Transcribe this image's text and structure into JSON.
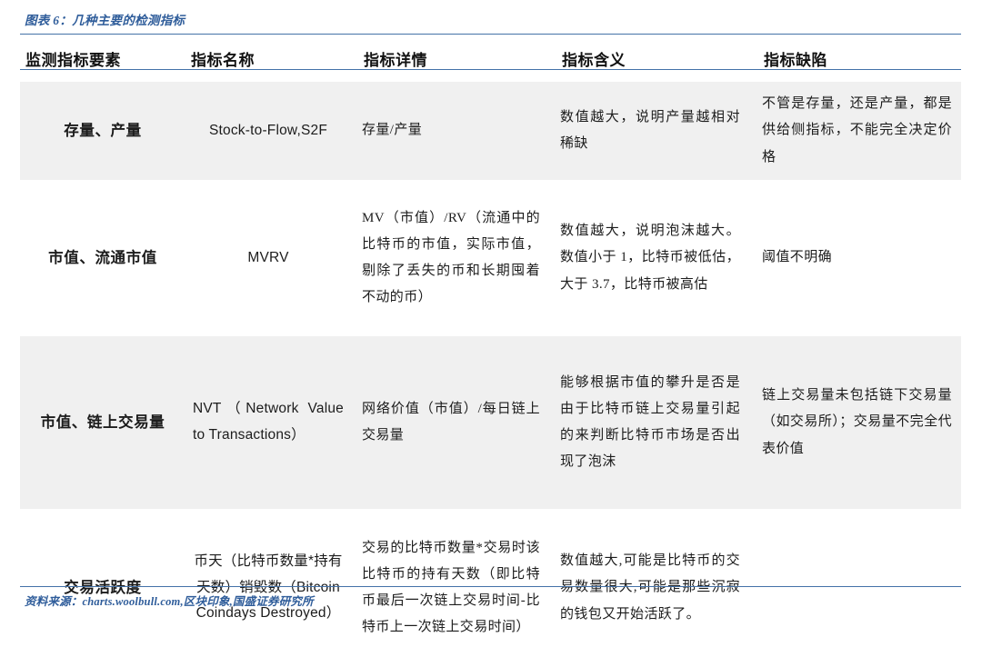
{
  "exhibit": {
    "title": "图表 6：几种主要的检测指标",
    "source": "资料来源：charts.woolbull.com,区块印象,国盛证券研究所",
    "accent_color": "#2e5c9a",
    "rule_color": "#4472a8",
    "shaded_row_color": "#f0f0f0"
  },
  "table": {
    "headers": [
      "监测指标要素",
      "指标名称",
      "指标详情",
      "指标含义",
      "指标缺陷"
    ],
    "rows": [
      {
        "element": "存量、产量",
        "name": "Stock-to-Flow,S2F",
        "detail": "存量/产量",
        "meaning": "数值越大，说明产量越相对稀缺",
        "flaw": "不管是存量，还是产量，都是供给侧指标，不能完全决定价格",
        "shaded": true
      },
      {
        "element": "市值、流通市值",
        "name": "MVRV",
        "detail": "MV（市值）/RV（流通中的比特币的市值，实际市值，剔除了丢失的币和长期囤着不动的币）",
        "meaning": "数值越大，说明泡沫越大。数值小于 1，比特币被低估，大于 3.7，比特币被高估",
        "flaw": "阈值不明确",
        "shaded": false
      },
      {
        "element": "市值、链上交易量",
        "name": "NVT（Network Value to Transactions）",
        "detail": "网络价值（市值）/每日链上交易量",
        "meaning": "能够根据市值的攀升是否是由于比特币链上交易量引起的来判断比特币市场是否出现了泡沫",
        "flaw": "链上交易量未包括链下交易量（如交易所）；交易量不完全代表价值",
        "shaded": true
      },
      {
        "element": "交易活跃度",
        "name": "币天（比特币数量*持有天数）销毁数（Bitcoin Coindays Destroyed）",
        "detail": "交易的比特币数量*交易时该比特币的持有天数（即比特币最后一次链上交易时间-比特币上一次链上交易时间）",
        "meaning": "数值越大,可能是比特币的交易数量很大,可能是那些沉寂的钱包又开始活跃了。",
        "flaw": "",
        "shaded": false
      }
    ]
  }
}
